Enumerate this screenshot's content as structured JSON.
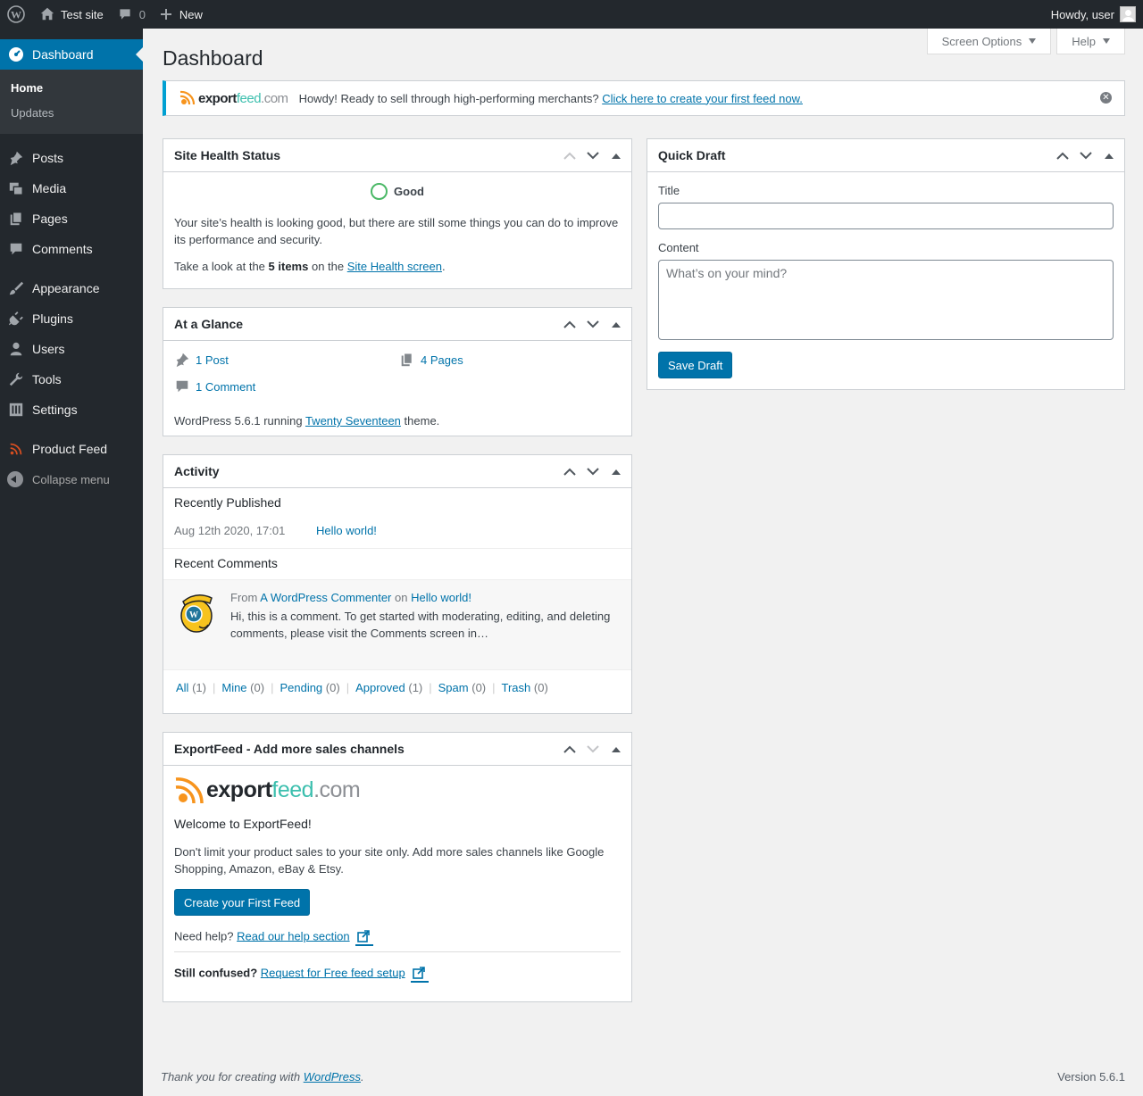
{
  "adminbar": {
    "site_name": "Test site",
    "comments_count": "0",
    "new_label": "New",
    "howdy": "Howdy, user"
  },
  "menu": {
    "dashboard": "Dashboard",
    "sub": {
      "home": "Home",
      "updates": "Updates"
    },
    "items": [
      {
        "label": "Posts",
        "icon": "pushpin-icon"
      },
      {
        "label": "Media",
        "icon": "media-icon"
      },
      {
        "label": "Pages",
        "icon": "pages-icon"
      },
      {
        "label": "Comments",
        "icon": "comment-icon"
      },
      {
        "label": "Appearance",
        "icon": "brush-icon"
      },
      {
        "label": "Plugins",
        "icon": "plug-icon"
      },
      {
        "label": "Users",
        "icon": "user-icon"
      },
      {
        "label": "Tools",
        "icon": "wrench-icon"
      },
      {
        "label": "Settings",
        "icon": "settings-icon"
      }
    ],
    "product_feed": "Product Feed",
    "collapse": "Collapse menu"
  },
  "screen_meta": {
    "screen_options": "Screen Options",
    "help": "Help"
  },
  "page_title": "Dashboard",
  "notice": {
    "logo": {
      "a": "export",
      "b": "feed",
      "c": ".com"
    },
    "text": "Howdy! Ready to sell through high-performing merchants?",
    "link": "Click here to create your first feed now."
  },
  "site_health": {
    "title": "Site Health Status",
    "status": "Good",
    "body": "Your site’s health is looking good, but there are still some things you can do to improve its performance and security.",
    "items_pre": "Take a look at the",
    "items_count": "5 items",
    "items_mid": "on the",
    "items_link": "Site Health screen",
    "items_post": "."
  },
  "glance": {
    "title": "At a Glance",
    "posts": "1 Post",
    "pages": "4 Pages",
    "comments": "1 Comment",
    "version_pre": "WordPress 5.6.1 running",
    "theme": "Twenty Seventeen",
    "version_post": "theme."
  },
  "activity": {
    "title": "Activity",
    "recently_published": "Recently Published",
    "date": "Aug 12th 2020, 17:01",
    "post": "Hello world!",
    "recent_comments": "Recent Comments",
    "from": "From",
    "author": "A WordPress Commenter",
    "on": "on",
    "on_post": "Hello world!",
    "excerpt": "Hi, this is a comment. To get started with moderating, editing, and deleting comments, please visit the Comments screen in…",
    "filters": [
      {
        "label": "All",
        "count": "(1)"
      },
      {
        "label": "Mine",
        "count": "(0)"
      },
      {
        "label": "Pending",
        "count": "(0)"
      },
      {
        "label": "Approved",
        "count": "(1)"
      },
      {
        "label": "Spam",
        "count": "(0)"
      },
      {
        "label": "Trash",
        "count": "(0)"
      }
    ]
  },
  "exportfeed": {
    "title": "ExportFeed - Add more sales channels",
    "logo": {
      "a": "export",
      "b": "feed",
      "c": ".com"
    },
    "welcome": "Welcome to ExportFeed!",
    "body": "Don't limit your product sales to your site only. Add more sales channels like Google Shopping, Amazon, eBay & Etsy.",
    "button": "Create your First Feed",
    "help_pre": "Need help?",
    "help_link": "Read our help section",
    "confused": "Still confused?",
    "confused_link": "Request for Free feed setup"
  },
  "quick_draft": {
    "title": "Quick Draft",
    "title_label": "Title",
    "content_label": "Content",
    "content_placeholder": "What’s on your mind?",
    "save": "Save Draft"
  },
  "footer": {
    "thanks_pre": "Thank you for creating with",
    "thanks_link": "WordPress",
    "thanks_post": ".",
    "version": "Version 5.6.1"
  },
  "colors": {
    "accent": "#0073aa",
    "adminbar": "#23282d",
    "notice_border": "#00a0d2",
    "good": "#4ab866",
    "exportfeed_orange": "#f7941d"
  }
}
